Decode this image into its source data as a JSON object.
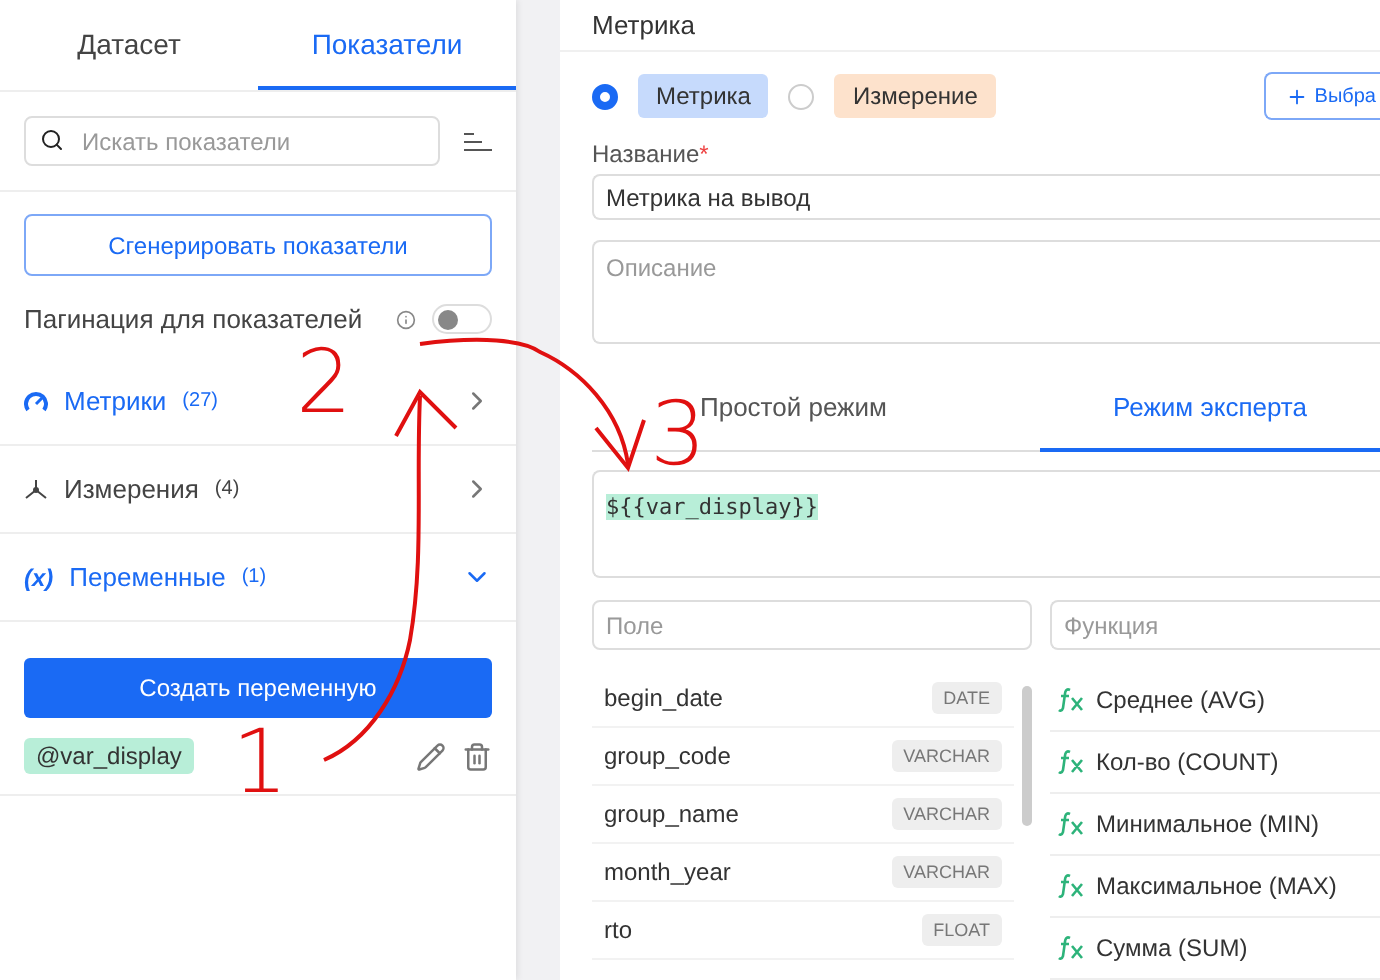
{
  "sidebar": {
    "tabs": [
      {
        "label": "Датасет",
        "selected": false
      },
      {
        "label": "Показатели",
        "selected": true
      }
    ],
    "search": {
      "placeholder": "Искать показатели"
    },
    "generate_button": "Сгенерировать показатели",
    "pagination": {
      "label": "Пагинация для показателей",
      "on": false
    },
    "groups": [
      {
        "kind": "metric",
        "label": "Метрики",
        "count": "(27)",
        "expanded": false
      },
      {
        "kind": "dimension",
        "label": "Измерения",
        "count": "(4)",
        "expanded": false
      },
      {
        "kind": "variable",
        "icon": "(x)",
        "label": "Переменные",
        "count": "(1)",
        "expanded": true
      }
    ],
    "create_button": "Создать переменную",
    "variables": [
      {
        "name": "@var_display"
      }
    ]
  },
  "editor": {
    "title": "Метрика",
    "types": [
      {
        "label": "Метрика",
        "selected": true,
        "color": "#c6dafc"
      },
      {
        "label": "Измерение",
        "selected": false,
        "color": "#fde2cc"
      }
    ],
    "select_button": "Выбра",
    "name": {
      "label": "Название",
      "required_mark": "*",
      "value": "Метрика на вывод"
    },
    "description": {
      "placeholder": "Описание"
    },
    "modes": [
      {
        "label": "Простой режим",
        "selected": false
      },
      {
        "label": "Режим эксперта",
        "selected": true
      }
    ],
    "expression": "${{var_display}}",
    "field_search": {
      "placeholder": "Поле"
    },
    "function_search": {
      "placeholder": "Функция"
    },
    "fields": [
      {
        "name": "begin_date",
        "type": "DATE"
      },
      {
        "name": "group_code",
        "type": "VARCHAR"
      },
      {
        "name": "group_name",
        "type": "VARCHAR"
      },
      {
        "name": "month_year",
        "type": "VARCHAR"
      },
      {
        "name": "rto",
        "type": "FLOAT"
      }
    ],
    "functions": [
      {
        "label": "Среднее (AVG)"
      },
      {
        "label": "Кол-во (COUNT)"
      },
      {
        "label": "Минимальное (MIN)"
      },
      {
        "label": "Максимальное (MAX)"
      },
      {
        "label": "Сумма (SUM)"
      }
    ]
  },
  "annotations": [
    {
      "label": "2"
    },
    {
      "label": "3"
    },
    {
      "label": "1"
    }
  ]
}
